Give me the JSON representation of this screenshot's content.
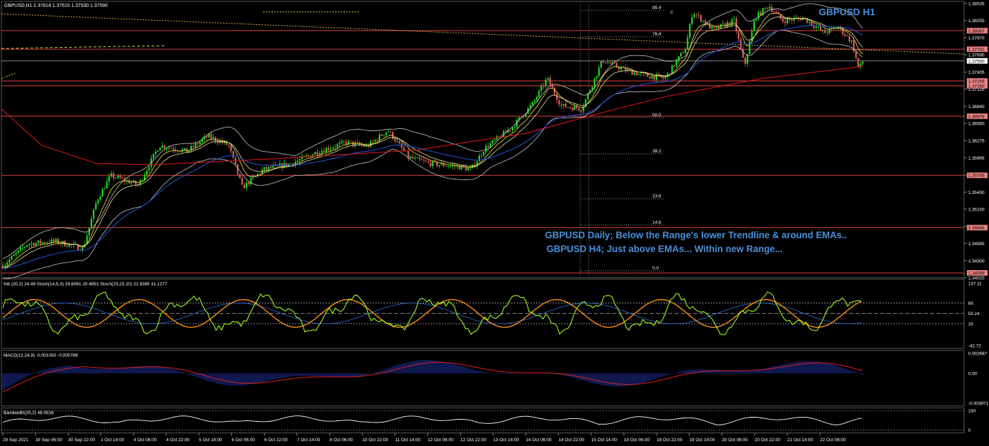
{
  "window": {
    "symbol_info": "GBPUSD,H1  1.37614 1.37615 1.37530 1.37590"
  },
  "colors": {
    "background": "#000000",
    "grid": "#3a3a3a",
    "level_line": "#e04040",
    "label_bg": "#e88080",
    "annotation": "#4a90d9",
    "ema_red": "#d01818",
    "ema_blue": "#2050d0",
    "ema_yellow": "#e0d040",
    "bollinger": "#c8c8c8",
    "bull": "#22dd22",
    "bear": "#e06060",
    "stoch_green": "#a0ff20",
    "stoch_orange": "#ff9010",
    "macd_hist": "#2030a0",
    "macd_signal": "#e02020"
  },
  "main_chart": {
    "title": "GBPUSD H1",
    "annotation_line1": "GBPUSD Daily; Below the Range's lower Trendline & around EMAs..",
    "annotation_line2": "GBPUSD H4; Just above EMAs... Within new Range...",
    "price_labels": [
      "1.38535",
      "1.38255",
      "1.37970",
      "1.37690",
      "1.37405",
      "1.37125",
      "1.36840",
      "1.36560",
      "1.36275",
      "1.35995",
      "1.35710",
      "1.35430",
      "1.35150",
      "1.34865",
      "1.34585",
      "1.34300",
      "1.34020"
    ],
    "levels": [
      {
        "price": "1.38087",
        "highlight": false
      },
      {
        "price": "1.37781",
        "highlight": false
      },
      {
        "price": "1.37590",
        "highlight": true
      },
      {
        "price": "1.37259",
        "highlight": false
      },
      {
        "price": "1.37180",
        "highlight": false
      },
      {
        "price": "1.36678",
        "highlight": false
      },
      {
        "price": "1.35705",
        "highlight": false
      },
      {
        "price": "1.34845",
        "highlight": false
      },
      {
        "price": "1.34099",
        "highlight": false
      }
    ],
    "fib_levels": [
      {
        "label": "85.4"
      },
      {
        "label": "76.4"
      },
      {
        "label": "50.0"
      },
      {
        "label": "38.2"
      },
      {
        "label": "23.6"
      },
      {
        "label": "14.6"
      },
      {
        "label": "0.0"
      }
    ],
    "marker_ii": "ii"
  },
  "stoch_panel": {
    "header": "%b (20,2) 24.49  Stoch(14,5,3) 29.6061 20.4851  Stoch(23,23,10) 22.9395 31.1277",
    "scale": [
      "137.11",
      "80",
      "50.24",
      "20",
      "-42.72"
    ]
  },
  "macd_panel": {
    "header": "MACD(12,24,9) -0.001050 -0.000789",
    "scale": [
      "0.002687",
      "0.00",
      "-0.003971"
    ]
  },
  "bw_panel": {
    "header": "Bandwidth(20,2) 48.9516",
    "scale": [
      "100",
      "0"
    ]
  },
  "time_axis": [
    "29 Sep 2021",
    "30 Sep 06:00",
    "30 Sep 22:00",
    "1 Oct 14:00",
    "4 Oct 06:00",
    "4 Oct 22:00",
    "5 Oct 14:00",
    "6 Oct 06:00",
    "6 Oct 22:00",
    "7 Oct 14:00",
    "8 Oct 06:00",
    "10 Oct 22:00",
    "11 Oct 14:00",
    "12 Oct 06:00",
    "12 Oct 22:00",
    "13 Oct 14:00",
    "14 Oct 06:00",
    "14 Oct 22:00",
    "15 Oct 14:00",
    "18 Oct 06:00",
    "18 Oct 22:00",
    "19 Oct 14:00",
    "20 Oct 06:00",
    "20 Oct 22:00",
    "21 Oct 14:00",
    "22 Oct 06:00"
  ]
}
